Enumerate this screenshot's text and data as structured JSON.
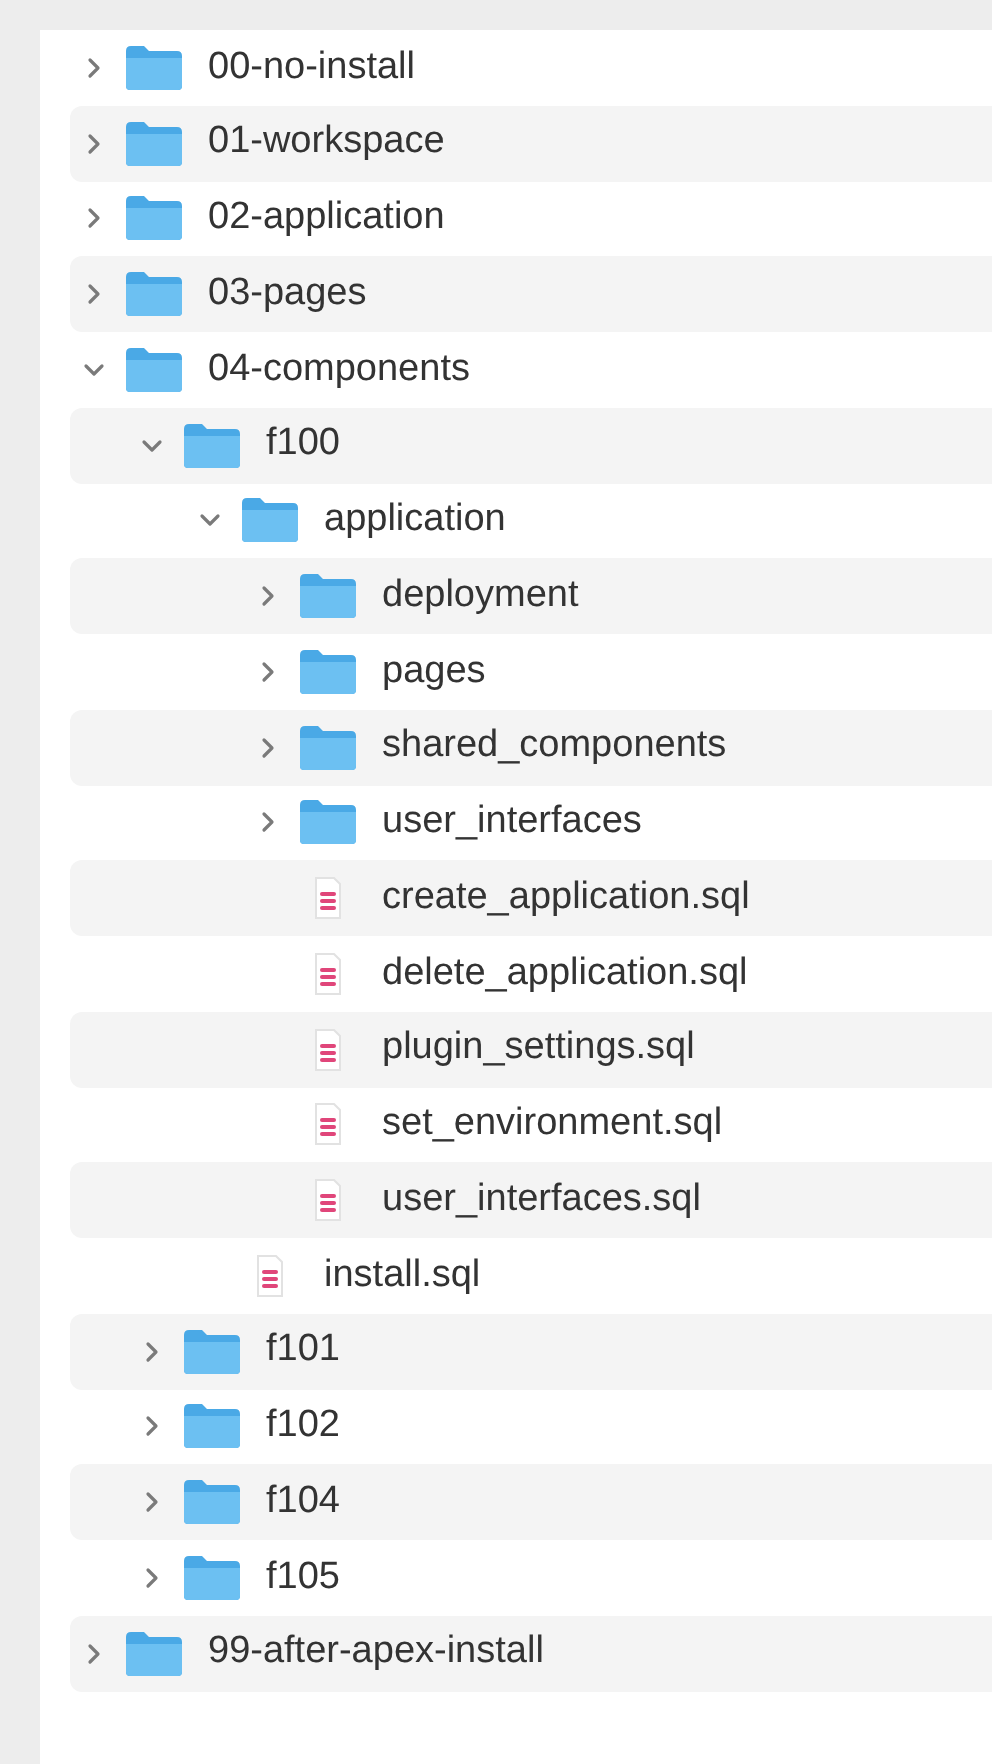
{
  "tree": [
    {
      "kind": "folder",
      "name": "00-no-install",
      "expanded": false
    },
    {
      "kind": "folder",
      "name": "01-workspace",
      "expanded": false
    },
    {
      "kind": "folder",
      "name": "02-application",
      "expanded": false
    },
    {
      "kind": "folder",
      "name": "03-pages",
      "expanded": false
    },
    {
      "kind": "folder",
      "name": "04-components",
      "expanded": true,
      "children": [
        {
          "kind": "folder",
          "name": "f100",
          "expanded": true,
          "children": [
            {
              "kind": "folder",
              "name": "application",
              "expanded": true,
              "children": [
                {
                  "kind": "folder",
                  "name": "deployment",
                  "expanded": false
                },
                {
                  "kind": "folder",
                  "name": "pages",
                  "expanded": false
                },
                {
                  "kind": "folder",
                  "name": "shared_components",
                  "expanded": false
                },
                {
                  "kind": "folder",
                  "name": "user_interfaces",
                  "expanded": false
                },
                {
                  "kind": "file",
                  "name": "create_application.sql"
                },
                {
                  "kind": "file",
                  "name": "delete_application.sql"
                },
                {
                  "kind": "file",
                  "name": "plugin_settings.sql"
                },
                {
                  "kind": "file",
                  "name": "set_environment.sql"
                },
                {
                  "kind": "file",
                  "name": "user_interfaces.sql"
                }
              ]
            },
            {
              "kind": "file",
              "name": "install.sql"
            }
          ]
        },
        {
          "kind": "folder",
          "name": "f101",
          "expanded": false
        },
        {
          "kind": "folder",
          "name": "f102",
          "expanded": false
        },
        {
          "kind": "folder",
          "name": "f104",
          "expanded": false
        },
        {
          "kind": "folder",
          "name": "f105",
          "expanded": false
        }
      ]
    },
    {
      "kind": "folder",
      "name": "99-after-apex-install",
      "expanded": false
    }
  ]
}
